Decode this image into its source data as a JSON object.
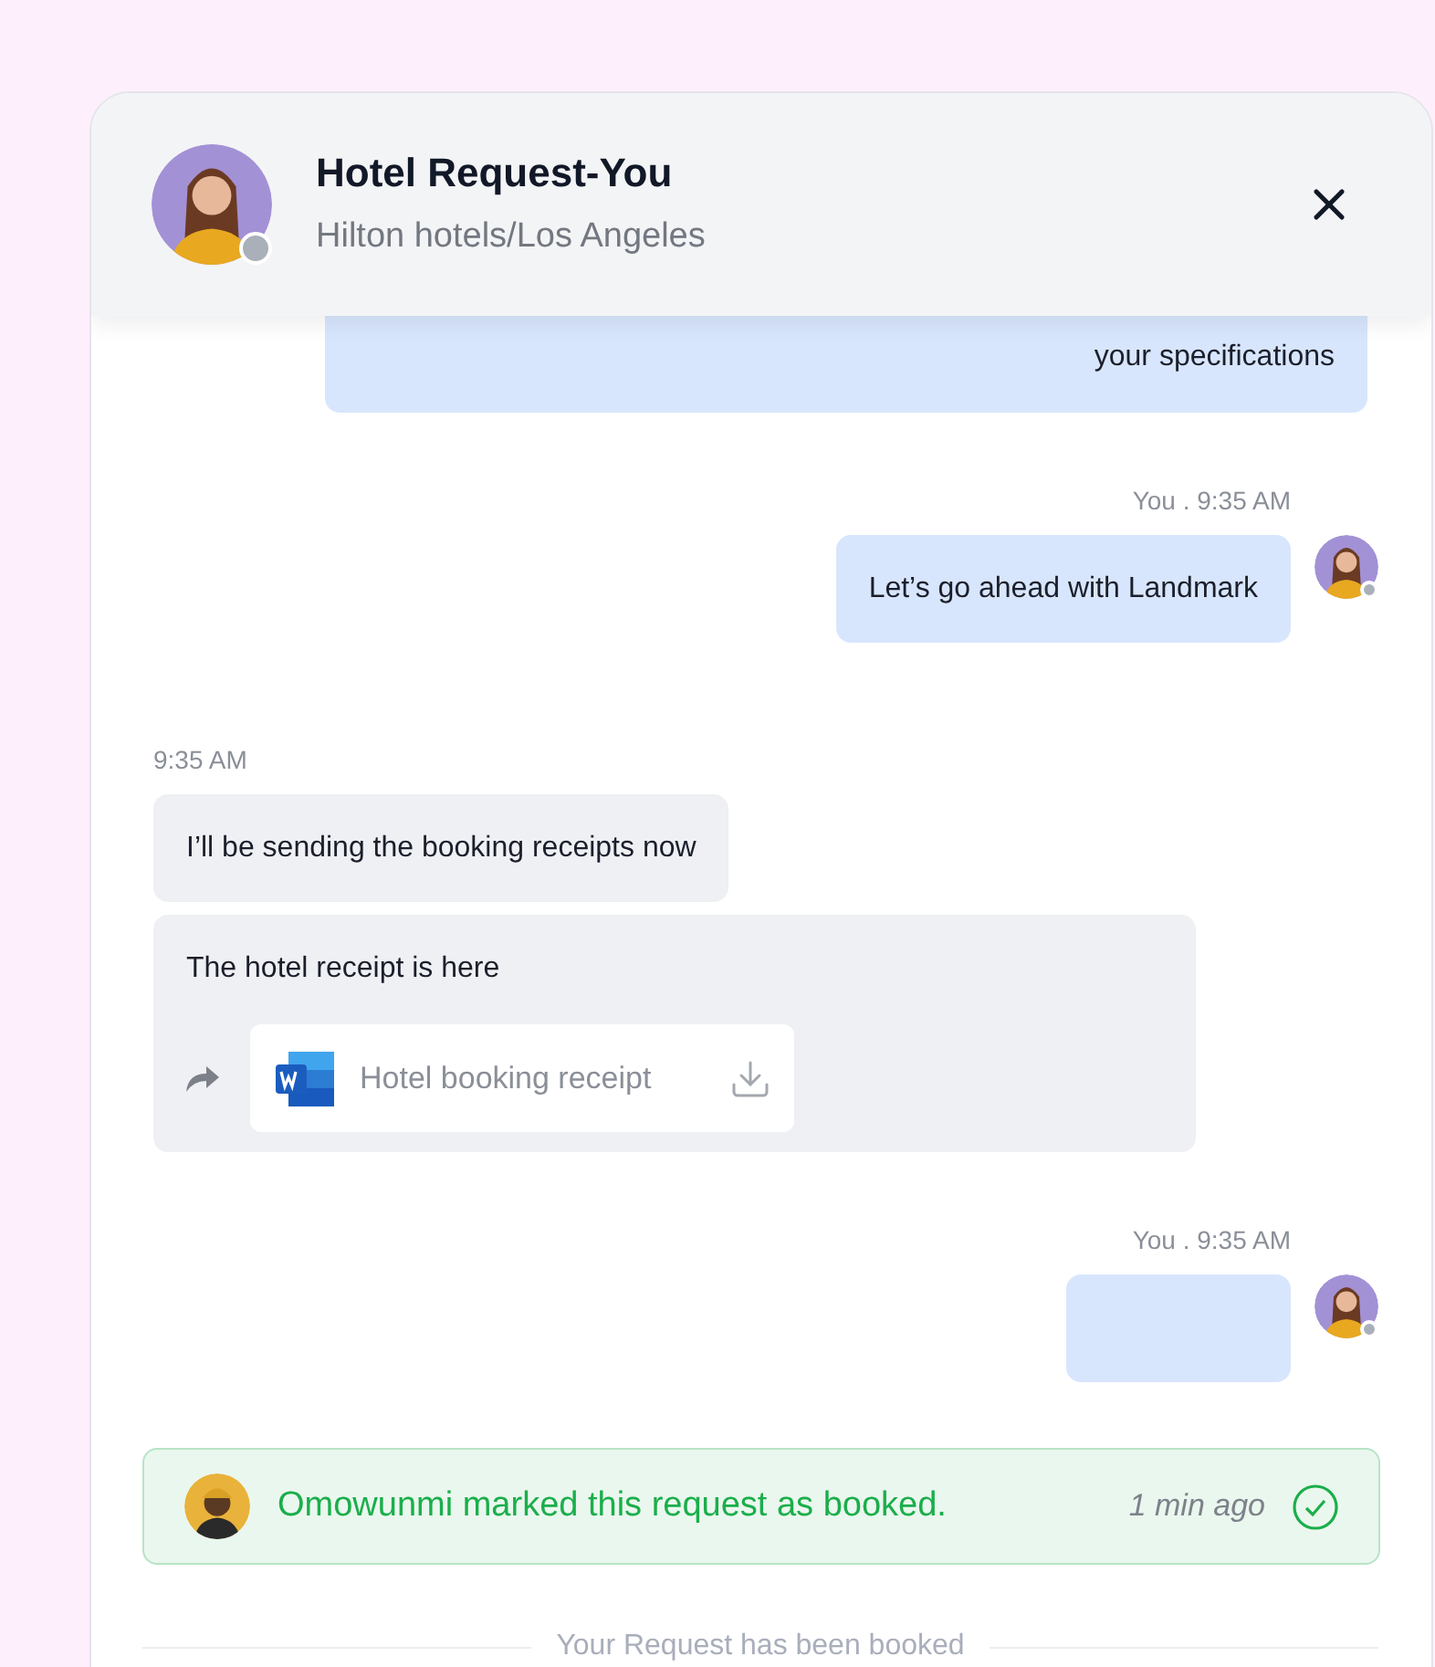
{
  "header": {
    "title": "Hotel Request-You",
    "subtitle": "Hilton hotels/Los Angeles"
  },
  "rows": [
    {
      "kind": "bubble-out",
      "text": "your specifications",
      "avatar": false
    },
    {
      "kind": "meta-out",
      "text": "You . 9:35 AM"
    },
    {
      "kind": "bubble-out",
      "text": "Let’s go ahead with Landmark",
      "avatar": true
    },
    {
      "kind": "meta-in",
      "text": "9:35 AM"
    },
    {
      "kind": "bubble-in",
      "text": "I’ll be sending the booking receipts now"
    },
    {
      "kind": "attachment-in",
      "text": "The hotel receipt is here",
      "file": "Hotel booking receipt"
    },
    {
      "kind": "meta-out",
      "text": "You . 9:35 AM"
    },
    {
      "kind": "bubble-out",
      "avatar": true
    },
    {
      "kind": "banner",
      "text": "Omowunmi marked this request as booked.",
      "time": "1 min ago"
    },
    {
      "kind": "divider",
      "text": "Your Request has been booked"
    }
  ]
}
